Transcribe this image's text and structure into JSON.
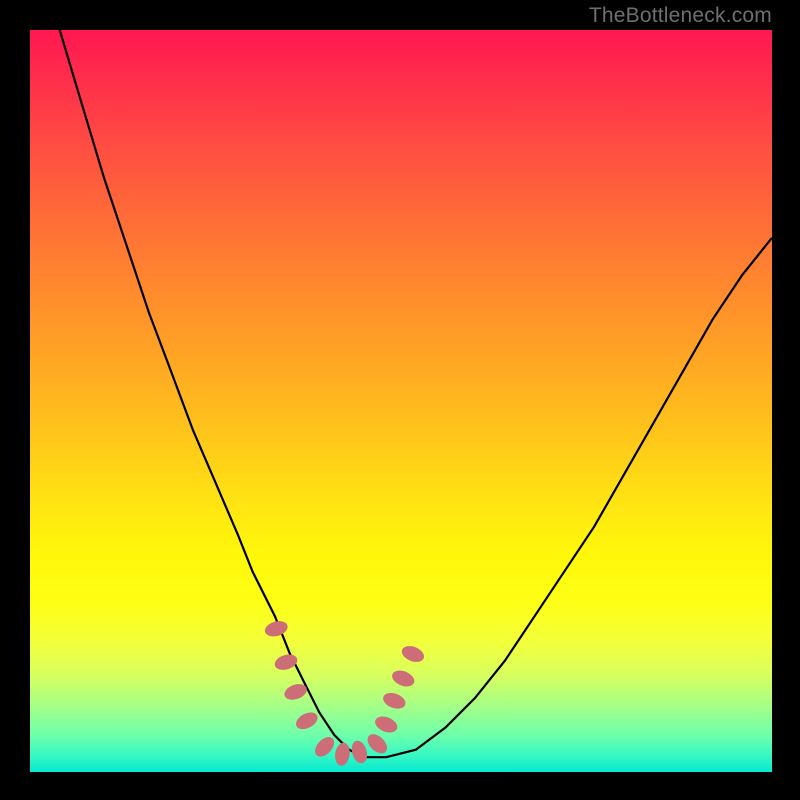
{
  "watermark": "TheBottleneck.com",
  "chart_data": {
    "type": "line",
    "title": "",
    "xlabel": "",
    "ylabel": "",
    "xlim": [
      0,
      100
    ],
    "ylim": [
      0,
      100
    ],
    "grid": false,
    "series": [
      {
        "name": "curve",
        "x": [
          4,
          7,
          10,
          13,
          16,
          19,
          22,
          25,
          28,
          30,
          33,
          35,
          37,
          39,
          41,
          43,
          45,
          48,
          52,
          56,
          60,
          64,
          68,
          72,
          76,
          80,
          84,
          88,
          92,
          96,
          100
        ],
        "values": [
          100,
          90,
          80,
          71,
          62,
          54,
          46,
          39,
          32,
          27,
          21,
          16,
          12,
          8,
          5,
          3,
          2,
          2,
          3,
          6,
          10,
          15,
          21,
          27,
          33,
          40,
          47,
          54,
          61,
          67,
          72
        ]
      }
    ],
    "annotations": {
      "dotted_segment": {
        "color": "#cc6d78",
        "points_x": [
          33.2,
          34.5,
          35.8,
          37.3,
          39.7,
          42.1,
          44.4,
          46.8,
          48.0,
          49.1,
          50.3,
          51.6
        ],
        "points_y": [
          19.3,
          14.8,
          10.8,
          6.9,
          3.4,
          2.4,
          2.7,
          3.8,
          6.4,
          9.6,
          12.6,
          15.9
        ]
      }
    },
    "background_gradient": {
      "top": "#ff1751",
      "bottom": "#05e8d0"
    }
  }
}
